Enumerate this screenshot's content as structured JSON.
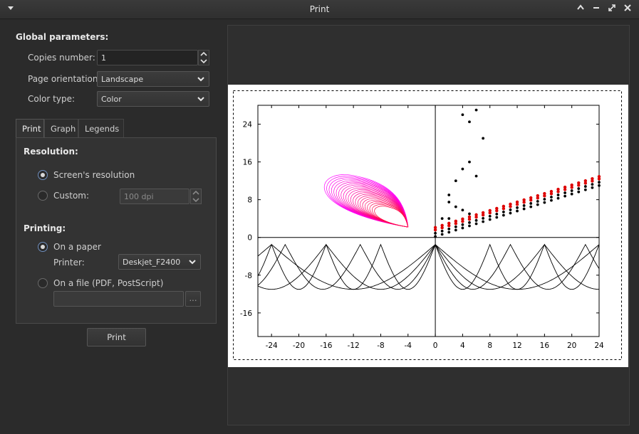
{
  "window": {
    "title": "Print"
  },
  "global": {
    "heading": "Global parameters:",
    "copies_label": "Copies number:",
    "copies_value": "1",
    "orientation_label": "Page orientation:",
    "orientation_value": "Landscape",
    "color_label": "Color type:",
    "color_value": "Color"
  },
  "tabs": [
    {
      "label": "Print"
    },
    {
      "label": "Graph"
    },
    {
      "label": "Legends"
    }
  ],
  "resolution": {
    "heading": "Resolution:",
    "screen_label": "Screen's resolution",
    "custom_label": "Custom:",
    "custom_value": "100 dpi",
    "selected": "screen"
  },
  "printing": {
    "heading": "Printing:",
    "paper_label": "On a paper",
    "printer_label": "Printer:",
    "printer_value": "Deskjet_F2400",
    "file_label": "On a file (PDF, PostScript)",
    "file_value": "",
    "browse_label": "...",
    "selected": "paper"
  },
  "print_button": "Print",
  "chart_data": {
    "type": "scatter",
    "xlim": [
      -26,
      24
    ],
    "ylim": [
      -21,
      28
    ],
    "xticks": [
      -24,
      -20,
      -16,
      -12,
      -8,
      -4,
      0,
      4,
      8,
      12,
      16,
      20,
      24
    ],
    "yticks": [
      -16,
      -8,
      0,
      8,
      16,
      24
    ],
    "x_tick_labels": [
      "-24",
      "-20",
      "-16",
      "-12",
      "-8",
      "-4",
      "0",
      "4",
      "8",
      "12",
      "16",
      "20",
      "24"
    ],
    "y_tick_labels": [
      "-16",
      "-8",
      "0",
      "8",
      "16",
      "24"
    ],
    "grid": false,
    "colors": {
      "black": "#000000",
      "red": "#dd0000",
      "magenta": "#ff00ff"
    },
    "dots_steep": [
      [
        4,
        26
      ],
      [
        5,
        24.5
      ],
      [
        6,
        27
      ],
      [
        7,
        21
      ]
    ],
    "dots_mid": [
      [
        2,
        9
      ],
      [
        3,
        12
      ],
      [
        4,
        14.5
      ],
      [
        5,
        16
      ],
      [
        6,
        13
      ],
      [
        3,
        6.5
      ],
      [
        4,
        5.8
      ],
      [
        5,
        5
      ],
      [
        2,
        7.5
      ],
      [
        1,
        4
      ],
      [
        2,
        4
      ]
    ]
  }
}
